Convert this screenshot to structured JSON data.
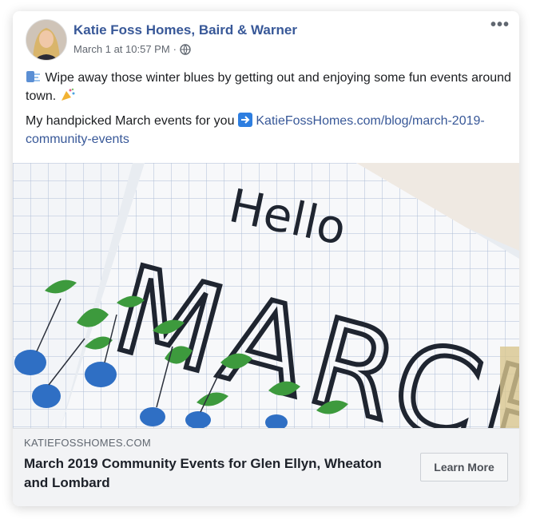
{
  "post": {
    "author": "Katie Foss Homes, Baird & Warner",
    "timestamp": "March 1 at 10:57 PM",
    "separator": "·",
    "privacy_icon": "globe-icon",
    "more_icon": "more-options-icon",
    "text_line1": "Wipe away those winter blues by getting out and enjoying some fun events around town.",
    "text_line2_prefix": "My handpicked March events for you",
    "link_text": "KatieFossHomes.com/blog/march-2019-community-events"
  },
  "image": {
    "handwritten_hello": "Hello",
    "handwritten_march": "MARCH"
  },
  "link_preview": {
    "domain": "KATIEFOSSHOMES.COM",
    "headline": "March 2019 Community Events for Glen Ellyn, Wheaton and Lombard",
    "cta_label": "Learn More"
  },
  "colors": {
    "name_link": "#385898",
    "meta_text": "#616770",
    "footer_bg": "#f2f3f5"
  }
}
